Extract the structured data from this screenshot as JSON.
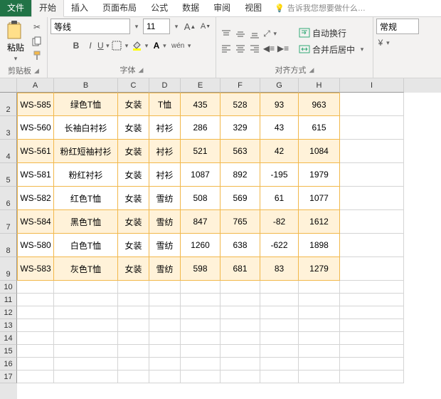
{
  "tabs": {
    "file": "文件",
    "home": "开始",
    "insert": "插入",
    "layout": "页面布局",
    "formulas": "公式",
    "data": "数据",
    "review": "审阅",
    "view": "视图",
    "tellme": "告诉我您想要做什么…"
  },
  "ribbon": {
    "clipboard": {
      "paste": "粘贴",
      "label": "剪贴板"
    },
    "font": {
      "name": "等线",
      "size": "11",
      "label": "字体"
    },
    "align": {
      "wrap": "自动换行",
      "merge": "合并后居中",
      "label": "对齐方式"
    },
    "number": {
      "format": "常规"
    }
  },
  "columns": [
    "A",
    "B",
    "C",
    "D",
    "E",
    "F",
    "G",
    "H",
    "I"
  ],
  "rows": [
    "2",
    "3",
    "4",
    "5",
    "6",
    "7",
    "8",
    "9",
    "10",
    "11",
    "12",
    "13",
    "14",
    "15",
    "16",
    "17"
  ],
  "data": [
    {
      "hl": true,
      "c": [
        "WS-585",
        "绿色T恤",
        "女装",
        "T恤",
        "435",
        "528",
        "93",
        "963"
      ]
    },
    {
      "hl": false,
      "c": [
        "WS-560",
        "长袖白衬衫",
        "女装",
        "衬衫",
        "286",
        "329",
        "43",
        "615"
      ]
    },
    {
      "hl": true,
      "c": [
        "WS-561",
        "粉红短袖衬衫",
        "女装",
        "衬衫",
        "521",
        "563",
        "42",
        "1084"
      ]
    },
    {
      "hl": false,
      "c": [
        "WS-581",
        "粉红衬衫",
        "女装",
        "衬衫",
        "1087",
        "892",
        "-195",
        "1979"
      ]
    },
    {
      "hl": false,
      "c": [
        "WS-582",
        "红色T恤",
        "女装",
        "雪纺",
        "508",
        "569",
        "61",
        "1077"
      ]
    },
    {
      "hl": true,
      "c": [
        "WS-584",
        "黑色T恤",
        "女装",
        "雪纺",
        "847",
        "765",
        "-82",
        "1612"
      ]
    },
    {
      "hl": false,
      "c": [
        "WS-580",
        "白色T恤",
        "女装",
        "雪纺",
        "1260",
        "638",
        "-622",
        "1898"
      ]
    },
    {
      "hl": true,
      "c": [
        "WS-583",
        "灰色T恤",
        "女装",
        "雪纺",
        "598",
        "681",
        "83",
        "1279"
      ]
    }
  ]
}
